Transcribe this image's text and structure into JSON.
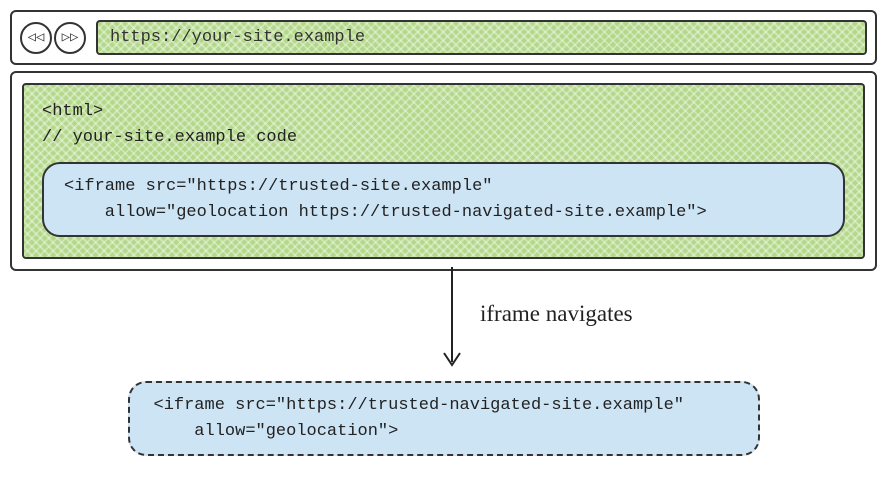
{
  "browser": {
    "back_icon": "◁◁",
    "forward_icon": "▷▷",
    "url": "https://your-site.example"
  },
  "page": {
    "code_line1": "<html>",
    "code_line2": "// your-site.example code",
    "iframe_line1": "<iframe src=\"https://trusted-site.example\"",
    "iframe_line2": "    allow=\"geolocation https://trusted-navigated-site.example\">"
  },
  "arrow_label": "iframe navigates",
  "navigated": {
    "iframe_line1": "<iframe src=\"https://trusted-navigated-site.example\"",
    "iframe_line2": "    allow=\"geolocation\">"
  }
}
